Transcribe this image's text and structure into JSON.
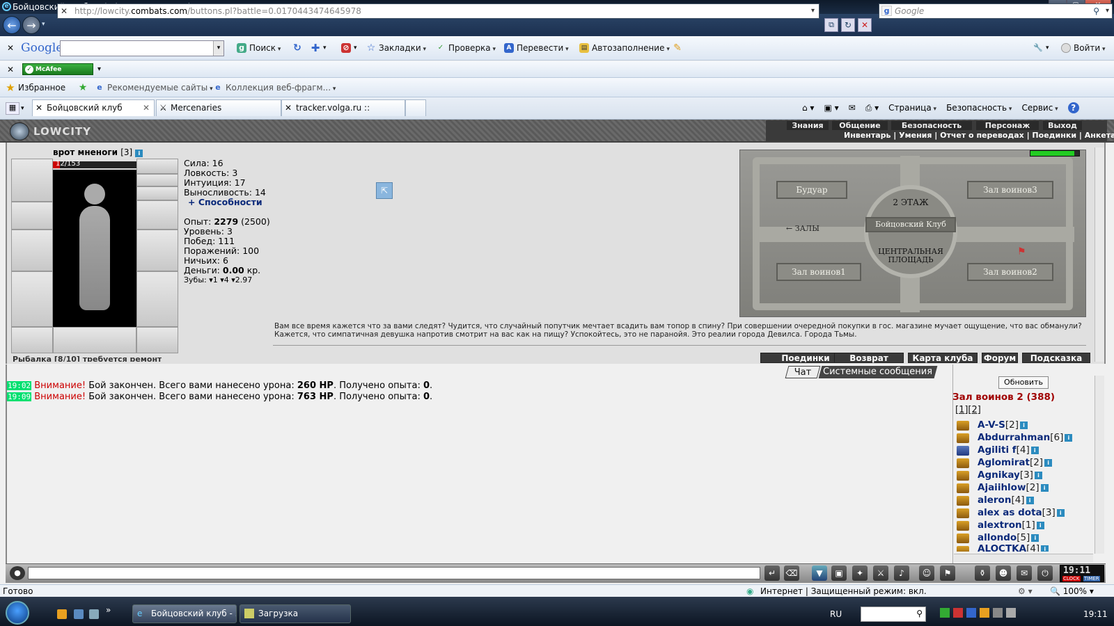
{
  "window": {
    "title": "Бойцовский клуб - Windows Internet Explorer"
  },
  "address": {
    "prefix": "http://lowcity.",
    "host": "combats.com",
    "path": "/buttons.pl?battle=0.0170443474645978",
    "search_placeholder": "Google"
  },
  "google_toolbar": {
    "brand": "Google",
    "search": "Поиск",
    "bookmarks": "Закладки",
    "check": "Проверка",
    "translate": "Перевести",
    "autofill": "Автозаполнение",
    "signin": "Войти"
  },
  "mcafee": {
    "label": "McAfee SiteAdvisor"
  },
  "favbar": {
    "favorites": "Избранное",
    "suggested": "Рекомендуемые сайты",
    "webslice": "Коллекция веб-фрагм..."
  },
  "tabs": [
    {
      "label": "Бойцовский клуб"
    },
    {
      "label": "Mercenaries"
    },
    {
      "label": "tracker.volga.ru :: Главная"
    }
  ],
  "cmdbar": {
    "page": "Страница",
    "safety": "Безопасность",
    "tools": "Сервис"
  },
  "game": {
    "logo": "LOWCITY",
    "menu_top": [
      "Знания",
      "Общение",
      "Безопасность",
      "Персонаж",
      "Выход"
    ],
    "menu_sub": "Инвентарь | Умения | Отчет о переводах | Поединки | Анкета",
    "char_name": "врот мненоги",
    "char_level": "[3]",
    "hp": "12/153",
    "stats": {
      "strength": "Сила: 16",
      "agility": "Ловкость: 3",
      "intuition": "Интуиция: 17",
      "endurance": "Выносливость: 14",
      "abilities": "+ Способности"
    },
    "exp_label": "Опыт: ",
    "exp_value": "2279",
    "exp_next": " (2500)",
    "level": "Уровень: 3",
    "wins": "Побед: 111",
    "losses": "Поражений: 100",
    "draws": "Ничьих: 6",
    "money_label": "Деньги: ",
    "money_value": "0.00",
    "money_unit": " кр.",
    "teeth": "Зубы: ▾1 ▾4 ▾2.97",
    "fishing": "Рыбалка [8/10] требуется ремонт",
    "map": {
      "floor": "2 ЭТАЖ",
      "club": "Бойцовский Клуб",
      "boudoir": "Будуар",
      "hall3": "Зал воинов3",
      "halls": "← ЗАЛЫ",
      "square": "ЦЕНТРАЛЬНАЯ ПЛОЩАДЬ",
      "hall1": "Зал воинов1",
      "hall2": "Зал воинов2"
    },
    "story": "Вам все время кажется что за вами следят? Чудится, что случайный попутчик мечтает всадить вам топор в спину? При совершении очередной покупки в гос. магазине мучает ощущение, что вас обманули? Кажется, что симпатичная девушка напротив смотрит на вас как на пищу? Успокойтесь, это не паранойя. Это реалии города Девилса. Города Тьмы.",
    "buttons": [
      "Поединки",
      "Возврат",
      "Карта клуба",
      "Форум",
      "Подсказка"
    ]
  },
  "chat": {
    "tabs": [
      "Чат",
      "Системные сообщения"
    ],
    "lines": [
      {
        "time": "19:02",
        "warn": "Внимание!",
        "text": " Бой закончен. Всего вами нанесено урона: ",
        "dmg": "260 HP",
        "text2": ". Получено опыта: ",
        "exp": "0",
        "end": "."
      },
      {
        "time": "19:09",
        "warn": "Внимание!",
        "text": " Бой закончен. Всего вами нанесено урона: ",
        "dmg": "763 HP",
        "text2": ". Получено опыта: ",
        "exp": "0",
        "end": "."
      }
    ]
  },
  "online": {
    "refresh": "Обновить",
    "room": "Зал воинов 2 (388)",
    "pages": "[1][2]",
    "users": [
      {
        "name": "A-V-S",
        "lvl": "[2]"
      },
      {
        "name": "Abdurrahman",
        "lvl": "[6]"
      },
      {
        "name": "Agiliti f",
        "lvl": "[4]"
      },
      {
        "name": "Aglomirat",
        "lvl": "[2]"
      },
      {
        "name": "Agnikay",
        "lvl": "[3]"
      },
      {
        "name": "Ajaiihlow",
        "lvl": "[2]"
      },
      {
        "name": "aleron",
        "lvl": "[4]"
      },
      {
        "name": "alex as dota",
        "lvl": "[3]"
      },
      {
        "name": "alextron",
        "lvl": "[1]"
      },
      {
        "name": "allondo",
        "lvl": "[5]"
      },
      {
        "name": "ALOCTKA",
        "lvl": "[4]"
      }
    ]
  },
  "clock": {
    "time": "19:11",
    "clock_label": "CLOCK",
    "timer_label": "TIMER"
  },
  "statusbar": {
    "ready": "Готово",
    "zone": "Интернет | Защищенный режим: вкл.",
    "zoom": "100%"
  },
  "taskbar": {
    "task1": "Бойцовский клуб - ...",
    "task2": "Загрузка",
    "lang": "RU",
    "time": "19:11"
  }
}
